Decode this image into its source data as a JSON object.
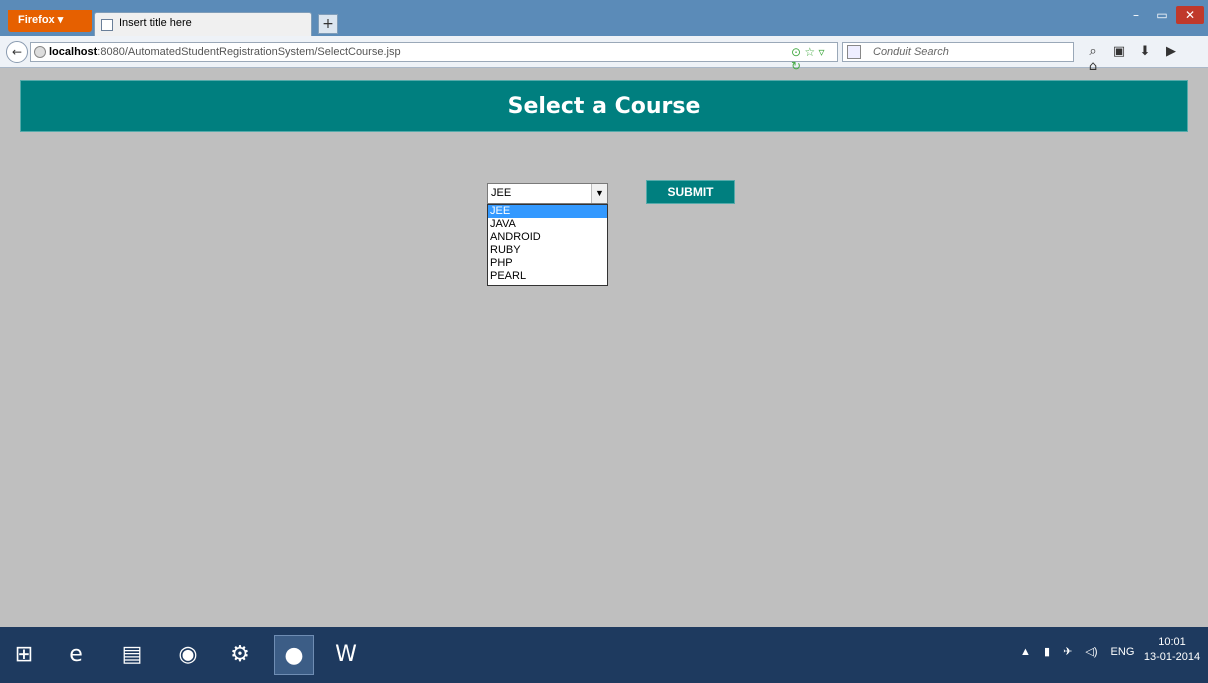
{
  "browser": {
    "app_button": "Firefox ▾",
    "tab_title": "Insert title here",
    "new_tab_label": "+",
    "url_host": "localhost",
    "url_rest": ":8080/AutomatedStudentRegistrationSystem/SelectCourse.jsp",
    "search_placeholder": "Conduit Search",
    "minimize": "–",
    "maximize": "▭",
    "close": "✕"
  },
  "page": {
    "title": "Select a Course",
    "select_value": "JEE",
    "options": [
      "JEE",
      "JAVA",
      "ANDROID",
      "RUBY",
      "PHP",
      "PEARL"
    ],
    "submit_label": "SUBMIT"
  },
  "taskbar": {
    "lang": "ENG",
    "time": "10:01",
    "date": "13-01-2014"
  },
  "colors": {
    "header_bg": "#007f7f",
    "page_bg": "#bfbfbf",
    "selected_option": "#3399ff"
  }
}
